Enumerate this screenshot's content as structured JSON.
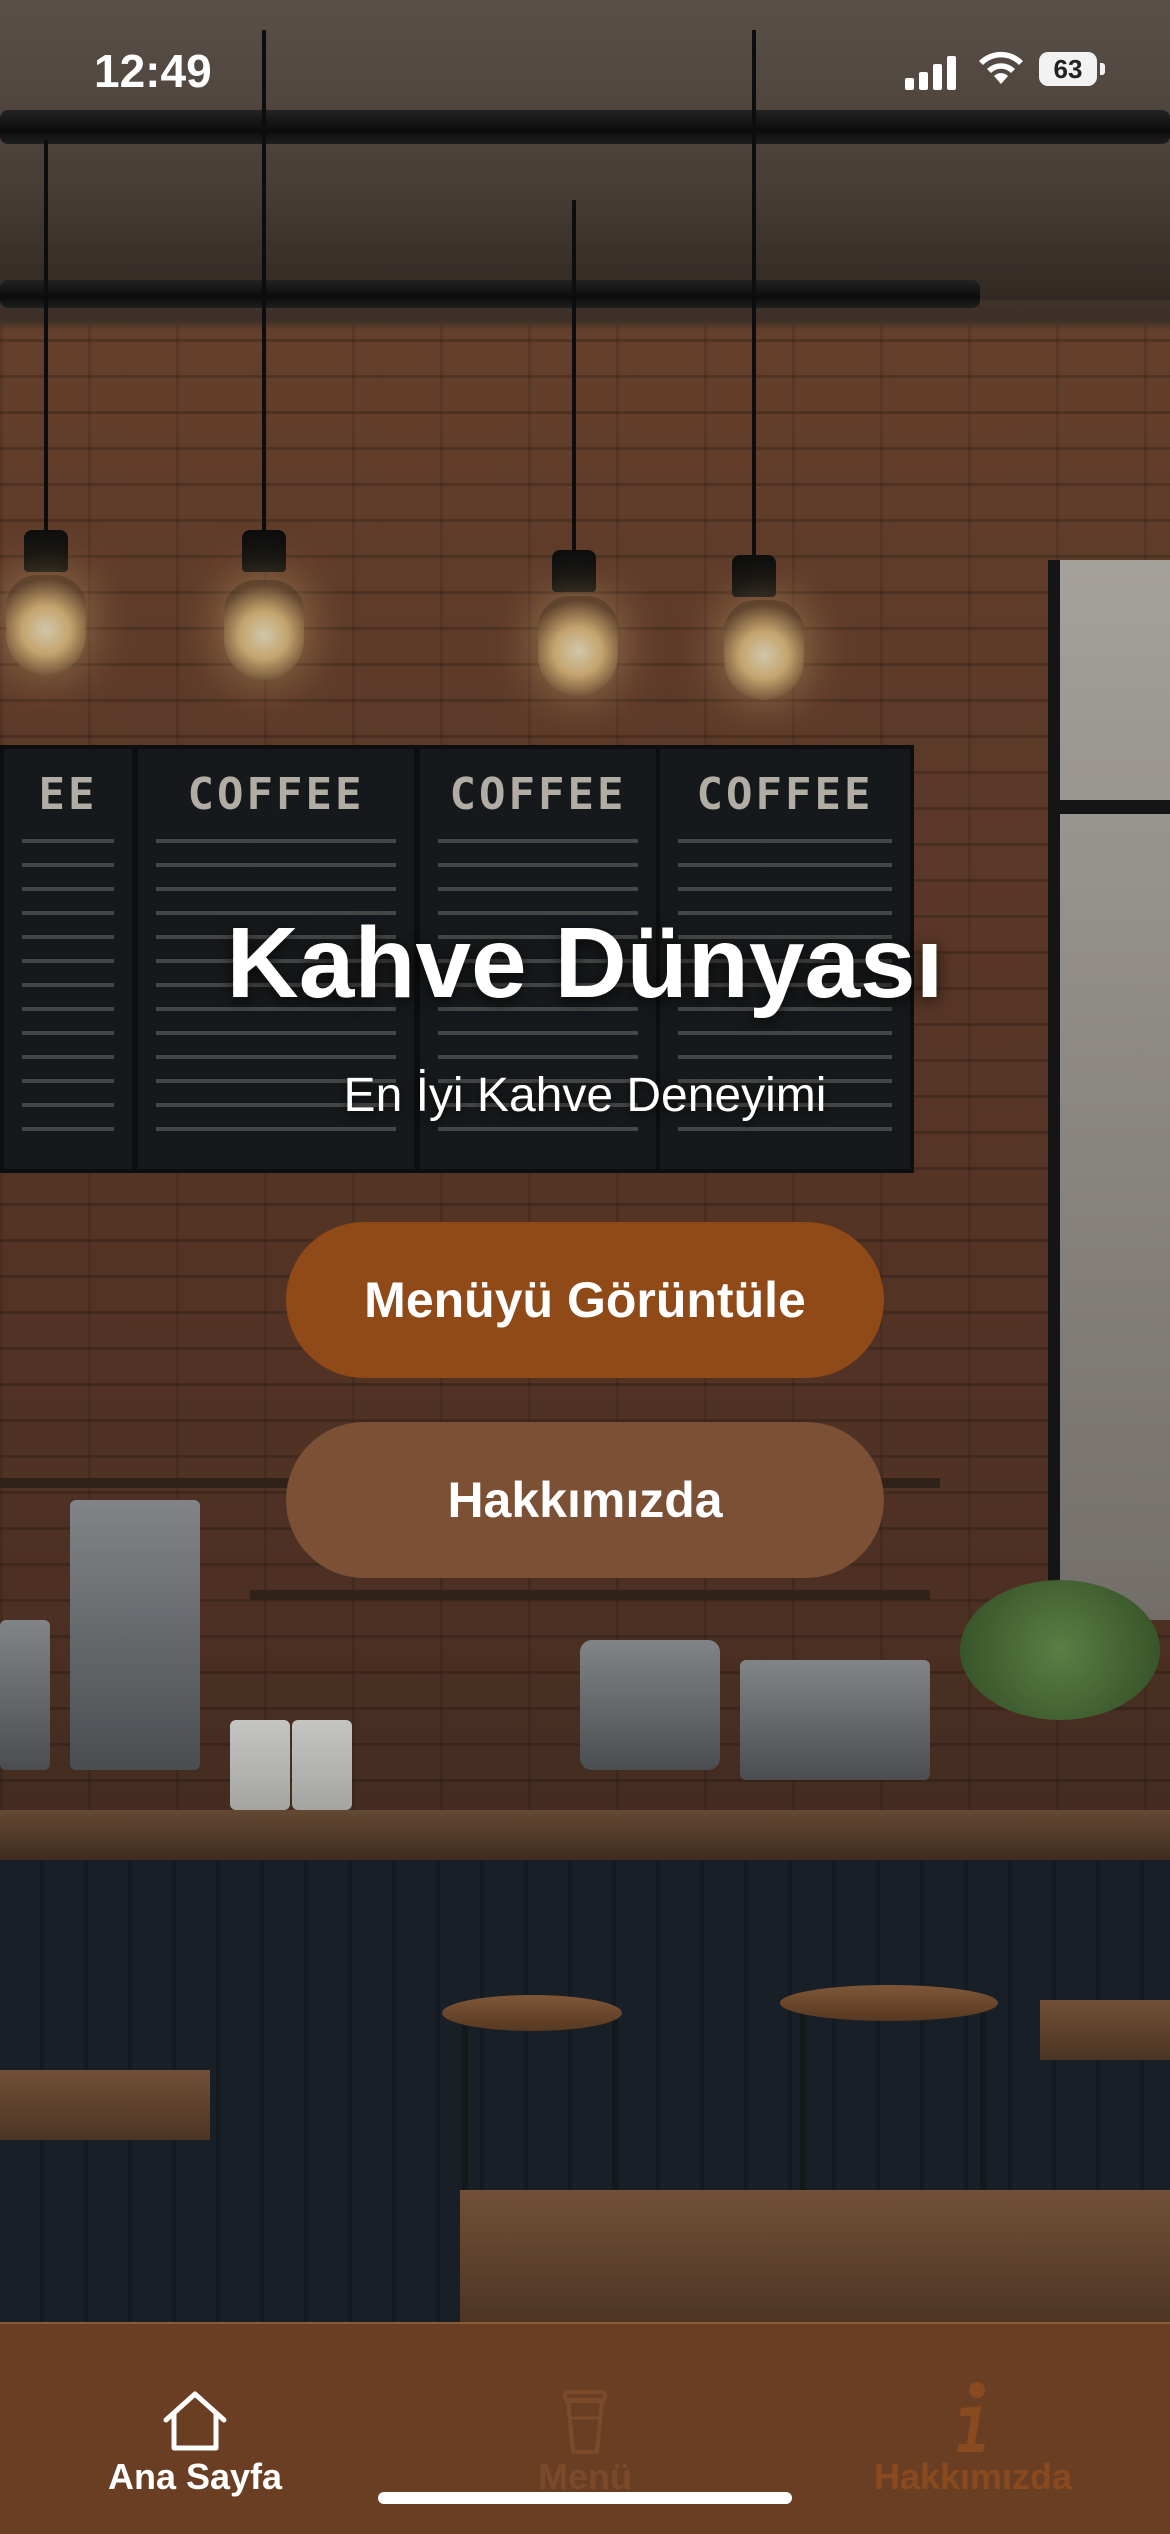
{
  "status_bar": {
    "time": "12:49",
    "battery": "63"
  },
  "hero": {
    "title": "Kahve Dünyası",
    "subtitle": "En İyi Kahve Deneyimi",
    "menu_boards": [
      "EE",
      "COFFEE",
      "COFFEE",
      "COFFEE"
    ]
  },
  "actions": {
    "primary_label": "Menüyü Görüntüle",
    "secondary_label": "Hakkımızda"
  },
  "tabbar": {
    "items": [
      {
        "label": "Ana Sayfa",
        "icon": "house-icon",
        "active": true
      },
      {
        "label": "Menü",
        "icon": "coffee-cup-icon",
        "active": false
      },
      {
        "label": "Hakkımızda",
        "icon": "info-icon",
        "active": false
      }
    ]
  },
  "colors": {
    "primary_button": "#8f4a18",
    "secondary_button": "#7b5035",
    "tabbar_bg": "#6a3e22"
  }
}
